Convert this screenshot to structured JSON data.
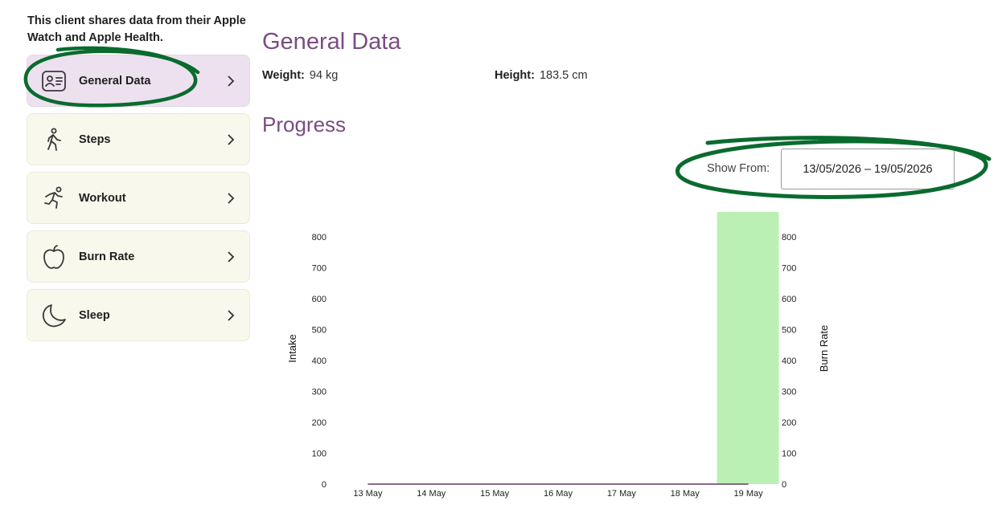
{
  "intro_text": "This client shares data from their Apple Watch and Apple Health.",
  "menu": [
    {
      "label": "General Data",
      "icon": "id-card-icon",
      "active": true
    },
    {
      "label": "Steps",
      "icon": "walking-icon",
      "active": false
    },
    {
      "label": "Workout",
      "icon": "running-icon",
      "active": false
    },
    {
      "label": "Burn Rate",
      "icon": "apple-icon",
      "active": false
    },
    {
      "label": "Sleep",
      "icon": "moon-icon",
      "active": false
    }
  ],
  "general": {
    "title": "General Data",
    "weight_label": "Weight:",
    "weight_value": "94 kg",
    "height_label": "Height:",
    "height_value": "183.5 cm"
  },
  "progress": {
    "title": "Progress",
    "show_from_label": "Show From:",
    "date_range": "13/05/2026  – 19/05/2026"
  },
  "colors": {
    "accent": "#7a4d82",
    "active_item_bg": "#ede1ef",
    "item_bg": "#f9f8ec",
    "annotation": "#0a6b2e",
    "bar": "#bbf0b5",
    "line": "#5e3c63"
  },
  "chart_data": {
    "type": "bar",
    "categories": [
      "13 May",
      "14 May",
      "15 May",
      "16 May",
      "17 May",
      "18 May",
      "19 May"
    ],
    "series": [
      {
        "name": "Burn Rate",
        "type": "bar",
        "axis": "right",
        "values": [
          0,
          0,
          0,
          0,
          0,
          0,
          880
        ]
      },
      {
        "name": "Intake",
        "type": "line",
        "axis": "left",
        "values": [
          0,
          0,
          0,
          0,
          0,
          0,
          0
        ]
      }
    ],
    "ylabel_left": "Intake",
    "ylabel_right": "Burn Rate",
    "yticks": [
      0,
      100,
      200,
      300,
      400,
      500,
      600,
      700,
      800
    ],
    "ylim": [
      0,
      880
    ]
  }
}
